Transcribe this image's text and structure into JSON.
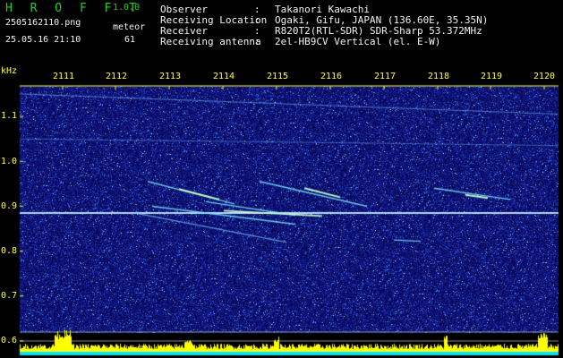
{
  "header": {
    "app_title": "H R O F F T",
    "app_version": "1.0.0",
    "filename": "2505162110.png",
    "meteor_label": "meteor",
    "datetime": "25.05.16 21:10",
    "meteor_count": "61",
    "colors": {
      "green": "#1bd61b",
      "white": "#f2f2f2",
      "yellow": "#ffff3a"
    }
  },
  "info": [
    {
      "key": "Observer",
      "value": "Takanori Kawachi"
    },
    {
      "key": "Receiving Location",
      "value": "Ogaki, Gifu, JAPAN (136.60E, 35.35N)"
    },
    {
      "key": "Receiver",
      "value": "R820T2(RTL-SDR) SDR-Sharp 53.372MHz"
    },
    {
      "key": "Receiving antenna",
      "value": "2el-HB9CV Vertical (el. E-W)"
    }
  ],
  "info_sep": ":",
  "spectrogram": {
    "y_unit": "kHz",
    "time_ticks": [
      "2111",
      "2112",
      "2113",
      "2114",
      "2115",
      "2116",
      "2117",
      "2118",
      "2119",
      "2120"
    ],
    "freq_ticks": [
      "1.1",
      "1.0",
      "0.9",
      "0.8",
      "0.7",
      "0.6"
    ],
    "freq_tick_values": [
      1.1,
      1.0,
      0.9,
      0.8,
      0.7,
      0.6
    ],
    "colors": {
      "background": "#0a0a5a",
      "bars": "#ffff00",
      "base": "#00ffff",
      "axis": "#ffff3a"
    }
  }
}
